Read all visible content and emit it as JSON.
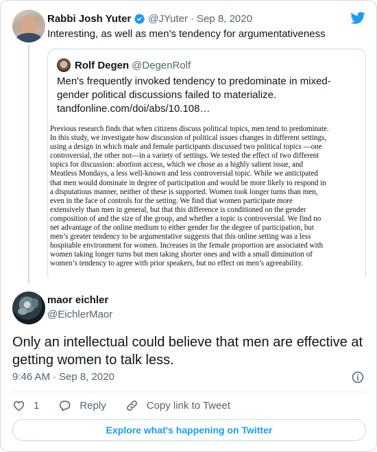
{
  "parent_tweet": {
    "author_name": "Rabbi Josh Yuter",
    "handle": "@JYuter",
    "separator": "·",
    "date": "Sep 8, 2020",
    "text": "Interesting, as well as men's tendency for argumentativeness",
    "verified": true
  },
  "quoted_tweet": {
    "author_name": "Rolf Degen",
    "handle": "@DegenRolf",
    "text_lines": [
      "Men's frequently invoked tendency to predominate in mixed-",
      "gender political discussions failed to materialize.",
      "tandfonline.com/doi/abs/10.108…"
    ],
    "abstract_lines": [
      "Previous research finds that when citizens discuss political topics, men tend to predominate.",
      "In this study, we investigate how discussion of political issues changes in different settings,",
      "using a design in which male and female participants discussed two political topics —one",
      "controversial, the other not—in a variety of settings. We tested the effect  of two different",
      "topics for discussion: abortion access, which we chose as a highly salient issue, and",
      "Meatless Mondays, a less well-known and less controversial topic. While we anticipated",
      "that men would dominate in degree of participation and would be more likely to respond in",
      "a disputatious manner, neither of these is  supported. Women took longer turns than men,",
      "even in the face of controls for the setting. We find that women participate more",
      "extensively than men in general, but that this difference is  conditioned on the gender",
      "composition of and the size of the group, and whether a topic is  controversial. We find no",
      "net advantage of the online medium to either gender for the degree of participation, but",
      "men’s greater tendency to be argumentative suggests that this online setting was a less",
      "hospitable environment for women. Increases in the female proportion are associated with",
      "women taking longer turns but men taking shorter ones and with a small diminution of",
      "women’s tendency to agree with prior speakers, but no effect on men’s agreeability."
    ]
  },
  "reply_tweet": {
    "author_name": "maor eichler",
    "handle": "@EichlerMaor",
    "text_lines": [
      "Only an intellectual could believe that men are effective at",
      "getting women to talk less."
    ],
    "time": "9:46 AM",
    "separator": "·",
    "date": "Sep 8, 2020"
  },
  "actions": {
    "like_count": "1",
    "reply_label": "Reply",
    "copy_link_label": "Copy link to Tweet"
  },
  "explore_label": "Explore what's happening on Twitter",
  "icons": {
    "verified": "verified-badge-icon",
    "logo": "twitter-bird-icon",
    "info": "info-icon",
    "like": "heart-icon",
    "reply": "reply-bubble-icon",
    "copy": "link-icon"
  },
  "colors": {
    "accent": "#1d9bf0",
    "text_primary": "#0f1419",
    "text_secondary": "#536471",
    "border": "#cfd9de"
  }
}
